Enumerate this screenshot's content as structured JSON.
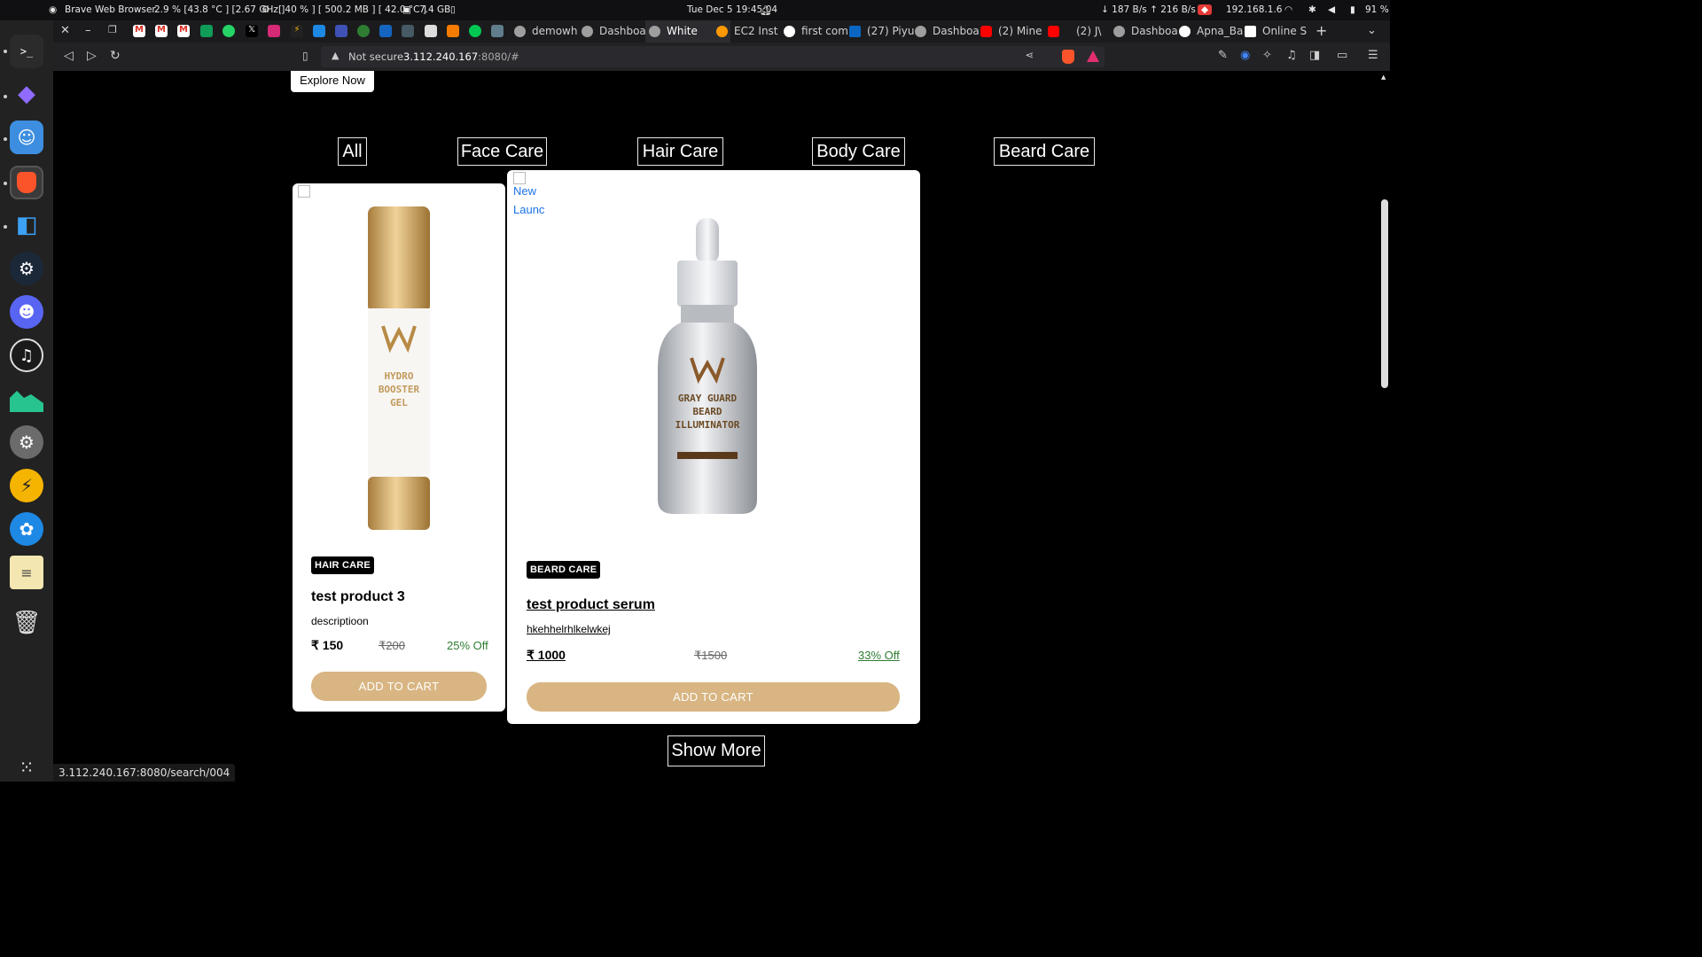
{
  "system_bar": {
    "app_name": "Brave Web Browser",
    "cpu_stats": "2.9 % [43.8 °C ] [2.67 GHz ]",
    "gpu_stats": "[ 40 % ] [ 500.2 MB ] [ 42.0 °C ]",
    "memory": "7.4 GB",
    "clock": "Tue Dec 5  19:45:04",
    "network": "↓ 187 B/s ↑ 216 B/s",
    "ip": "192.168.1.6",
    "battery": "91 %"
  },
  "tabs": [
    {
      "label": "demowh",
      "color": "#9e9e9e"
    },
    {
      "label": "Dashboa",
      "color": "#9e9e9e"
    },
    {
      "label": "White",
      "color": "#9e9e9e",
      "active": true
    },
    {
      "label": "EC2 Inst",
      "color": "#ff9900"
    },
    {
      "label": "first com",
      "color": "#ffffff"
    },
    {
      "label": "(27) Piyu",
      "color": "#0a66c2"
    },
    {
      "label": "Dashboa",
      "color": "#9e9e9e"
    },
    {
      "label": "(2) Mine",
      "color": "#ff0000"
    },
    {
      "label": "(2) J\\",
      "color": "#ff0000"
    },
    {
      "label": "Dashboa",
      "color": "#9e9e9e"
    },
    {
      "label": "Apna_Ba",
      "color": "#ffffff"
    },
    {
      "label": "Online S",
      "color": "#ffffff"
    }
  ],
  "address_bar": {
    "security_label": "Not secure",
    "url_host": "3.112.240.167",
    "url_rest": ":8080/#"
  },
  "page": {
    "explore_label": "Explore Now",
    "filters": [
      "All",
      "Face Care",
      "Hair Care",
      "Body Care",
      "Beard Care"
    ],
    "products": [
      {
        "category": "HAIR CARE",
        "title": "test product 3",
        "description": "descriptioon",
        "price": "₹ 150",
        "mrp": "₹200",
        "discount": "25% Off",
        "button": "ADD TO CART",
        "bottle_lines": [
          "HYDRO",
          "BOOSTER",
          "GEL"
        ]
      },
      {
        "image_alt": "New Launch",
        "category": "BEARD CARE",
        "title": "test product serum",
        "description": "hkehhelrhlkelwkej",
        "price": "₹ 1000",
        "mrp": "₹1500",
        "discount": "33% Off",
        "button": "ADD TO CART",
        "bottle_lines": [
          "GRAY GUARD",
          "BEARD",
          "ILLUMINATOR"
        ]
      }
    ],
    "show_more": "Show More"
  },
  "status_url": "3.112.240.167:8080/search/004",
  "colors": {
    "accent": "#d8b582",
    "discount_green": "#2e7d32",
    "page_bg": "#000000"
  }
}
